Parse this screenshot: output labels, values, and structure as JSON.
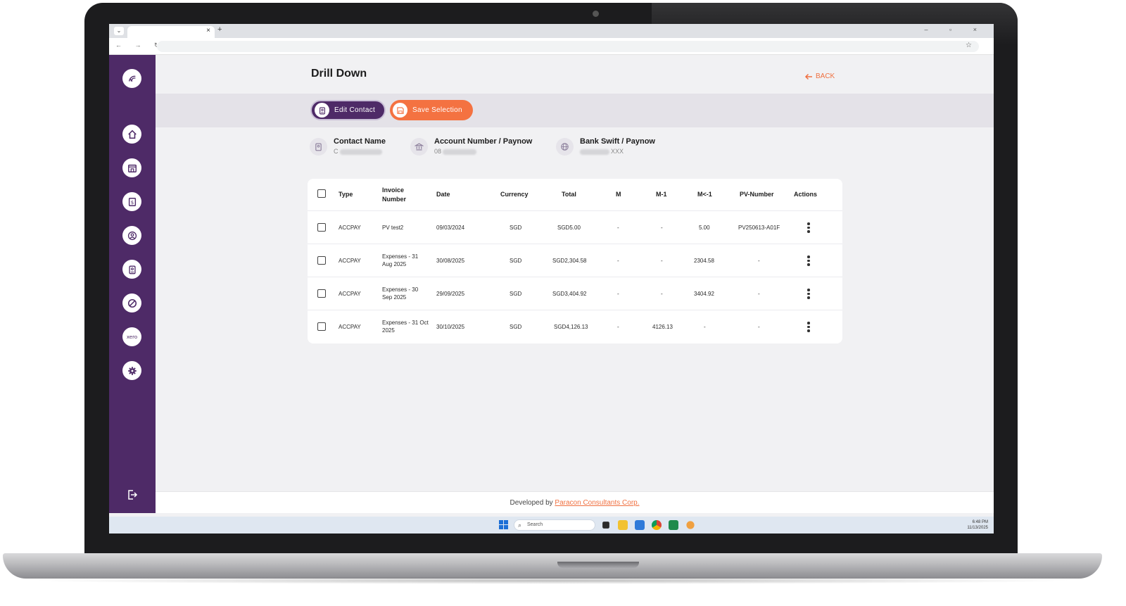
{
  "browser": {
    "tab_close": "×",
    "tab_new": "+",
    "window_controls": "– ▫ ×",
    "nav": "← → ↻",
    "bookmark": "☆"
  },
  "sidebar": {
    "items": [
      {
        "icon": "brand-logo-icon"
      },
      {
        "icon": "home-icon"
      },
      {
        "icon": "bank-building-icon"
      },
      {
        "icon": "dollar-document-icon"
      },
      {
        "icon": "user-circle-icon"
      },
      {
        "icon": "id-badge-icon"
      },
      {
        "icon": "block-icon"
      },
      {
        "icon": "xero-icon",
        "label": "xero"
      },
      {
        "icon": "gear-icon"
      }
    ],
    "logout_icon": "logout-icon"
  },
  "header": {
    "title": "Drill Down",
    "back_label": "BACK"
  },
  "toolbar": {
    "edit_label": "Edit Contact",
    "save_label": "Save Selection"
  },
  "contact": {
    "name_label": "Contact Name",
    "name_value": "C",
    "account_label": "Account Number / Paynow",
    "account_value": "08",
    "swift_label": "Bank Swift / Paynow",
    "swift_value": "XXX"
  },
  "table": {
    "headers": [
      "Type",
      "Invoice\nNumber",
      "Date",
      "Currency",
      "Total",
      "M",
      "M-1",
      "M<-1",
      "PV-Number",
      "Actions"
    ],
    "rows": [
      {
        "type": "ACCPAY",
        "invoice": "PV test2",
        "date": "09/03/2024",
        "currency": "SGD",
        "total": "SGD5.00",
        "m": "-",
        "m1": "-",
        "mlt1": "5.00",
        "pv": "PV250613-A01F"
      },
      {
        "type": "ACCPAY",
        "invoice": "Expenses - 31 Aug 2025",
        "date": "30/08/2025",
        "currency": "SGD",
        "total": "SGD2,304.58",
        "m": "-",
        "m1": "-",
        "mlt1": "2304.58",
        "pv": "-"
      },
      {
        "type": "ACCPAY",
        "invoice": "Expenses - 30 Sep 2025",
        "date": "29/09/2025",
        "currency": "SGD",
        "total": "SGD3,404.92",
        "m": "-",
        "m1": "-",
        "mlt1": "3404.92",
        "pv": "-"
      },
      {
        "type": "ACCPAY",
        "invoice": "Expenses - 31 Oct 2025",
        "date": "30/10/2025",
        "currency": "SGD",
        "total": "SGD4,126.13",
        "m": "-",
        "m1": "4126.13",
        "mlt1": "-",
        "pv": "-"
      }
    ]
  },
  "footer": {
    "prefix": "Developed by ",
    "link": "Paracon Consultants Corp."
  },
  "taskbar": {
    "search_placeholder": "Search",
    "time": "6:48 PM",
    "date": "11/13/2025"
  },
  "colors": {
    "sidebar": "#4e2a67",
    "accent": "#f47241"
  }
}
